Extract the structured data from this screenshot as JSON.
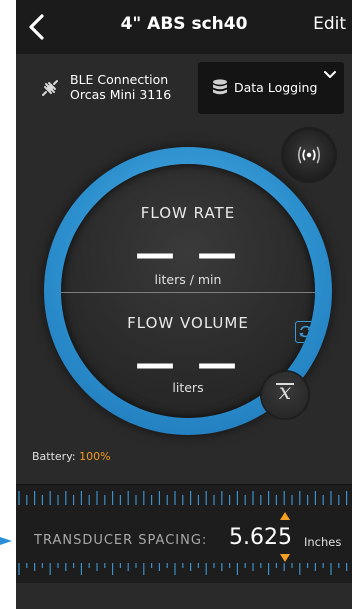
{
  "header": {
    "title": "4\" ABS sch40",
    "edit_label": "Edit"
  },
  "connection": {
    "line1": "BLE Connection",
    "line2": "Orcas Mini 3116"
  },
  "data_logging": {
    "label": "Data Logging"
  },
  "flow_rate": {
    "title": "FLOW  RATE",
    "value": "— —",
    "unit": "liters / min"
  },
  "flow_volume": {
    "title": "FLOW VOLUME",
    "value": "— —",
    "unit": "liters"
  },
  "battery": {
    "label": "Battery:",
    "value": "100%"
  },
  "transducer": {
    "label": "TRANSDUCER SPACING:",
    "value": "5.625",
    "unit": "Inches"
  },
  "colors": {
    "accent_blue": "#2c8fcd",
    "battery_orange": "#f29a1e",
    "arrow_orange": "#f5a020"
  },
  "icons": [
    "back-chevron-icon",
    "bluetooth-disconnected-icon",
    "database-icon",
    "chevron-down-icon",
    "signal-broadcast-icon",
    "swap-units-icon",
    "x-bar-mean-icon",
    "increase-arrow-icon",
    "decrease-arrow-icon"
  ]
}
